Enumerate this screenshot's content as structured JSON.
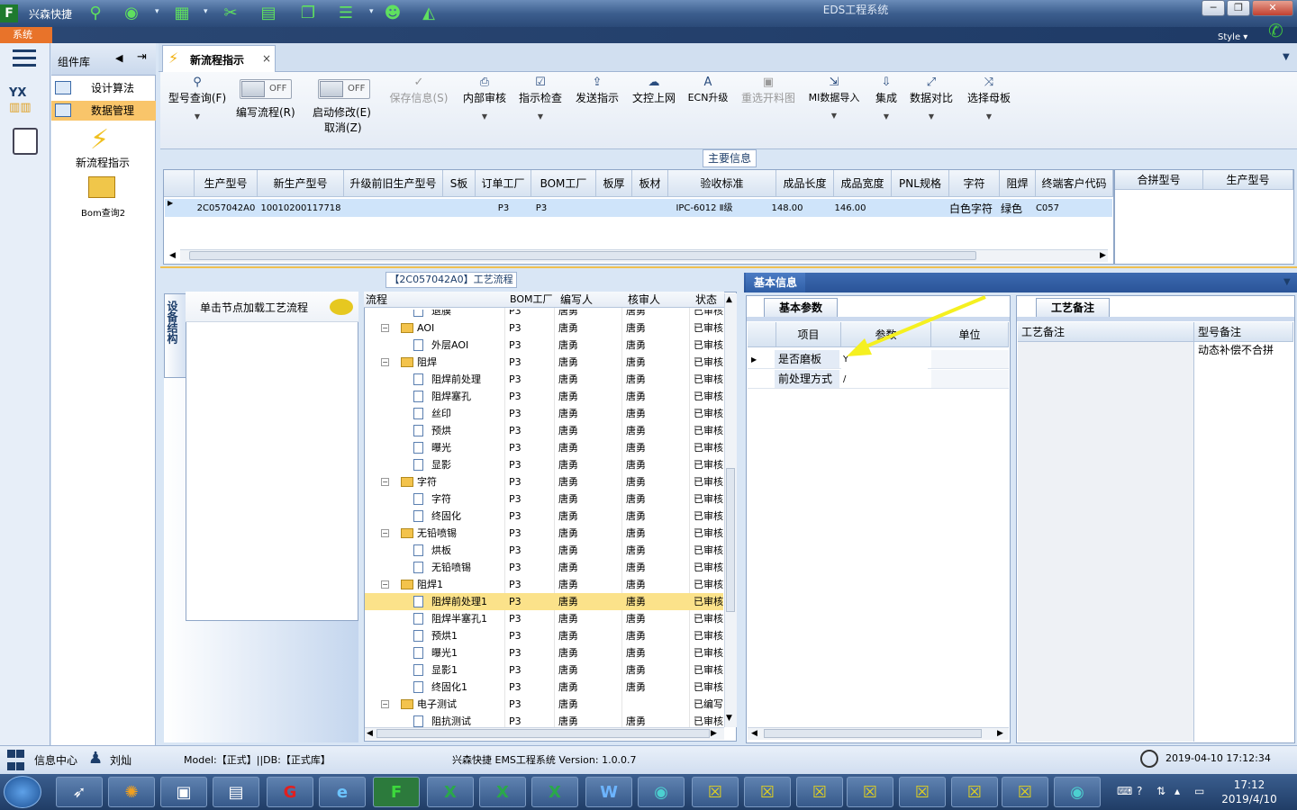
{
  "window": {
    "app_name": "兴森快捷",
    "title": "EDS工程系统",
    "minimize": "─",
    "maximize": "❐",
    "close": "✕"
  },
  "system_tab": "系统",
  "style_label": "Style ▾",
  "sidebar": {
    "title": "组件库",
    "logo_text": "YX",
    "items": [
      {
        "label": "设计算法"
      },
      {
        "label": "数据管理"
      }
    ],
    "shortcuts": [
      {
        "label": "新流程指示",
        "icon": "lightning-icon"
      },
      {
        "label": "Bom查询2",
        "icon": "folder-icon"
      }
    ]
  },
  "doc_tab": {
    "label": "新流程指示",
    "close": "×"
  },
  "toolbar": {
    "items": [
      {
        "label": "型号查询(F)",
        "icon": "search-icon",
        "disabled": false
      },
      {
        "label": "编写流程(R)",
        "toggle": "OFF",
        "disabled": false
      },
      {
        "label": "启动修改(E)",
        "sub": "取消(Z)",
        "toggle": "OFF",
        "disabled": false
      },
      {
        "label": "保存信息(S)",
        "icon": "check-icon",
        "disabled": true
      },
      {
        "label": "内部审核",
        "icon": "printer-icon",
        "disabled": false
      },
      {
        "label": "指示检查",
        "icon": "checkbox-icon",
        "disabled": false
      },
      {
        "label": "发送指示",
        "icon": "upload-icon",
        "disabled": false
      },
      {
        "label": "文控上网",
        "icon": "cloud-upload-icon",
        "disabled": false
      },
      {
        "label": "ECN升级",
        "icon": "font-icon",
        "disabled": false
      },
      {
        "label": "重选开料图",
        "icon": "image-icon",
        "disabled": true
      },
      {
        "label": "MI数据导入",
        "icon": "import-icon",
        "disabled": false
      },
      {
        "label": "集成",
        "icon": "download-icon",
        "disabled": false
      },
      {
        "label": "数据对比",
        "icon": "compare-icon",
        "disabled": false
      },
      {
        "label": "选择母板",
        "icon": "shuffle-icon",
        "disabled": false
      }
    ]
  },
  "main_info": {
    "caption": "主要信息",
    "columns": [
      "生产型号",
      "新生产型号",
      "升级前旧生产型号",
      "S板",
      "订单工厂",
      "BOM工厂",
      "板厚",
      "板材",
      "验收标准",
      "成品长度",
      "成品宽度",
      "PNL规格",
      "字符",
      "阻焊",
      "终端客户代码"
    ],
    "rows": [
      [
        "2C057042A0",
        "10010200117718",
        "",
        "",
        "P3",
        "P3",
        "",
        "",
        "IPC-6012 Ⅱ级",
        "148.00",
        "146.00",
        "",
        "白色字符",
        "绿色",
        "C057"
      ]
    ],
    "side_columns": [
      "合拼型号",
      "生产型号"
    ]
  },
  "side_tab": "设备结构",
  "node_panel": {
    "label": "单击节点加载工艺流程"
  },
  "tree": {
    "caption": "【2C057042A0】工艺流程",
    "columns": [
      "流程",
      "BOM工厂",
      "编写人",
      "核审人",
      "状态"
    ],
    "rows": [
      {
        "level": 1,
        "type": "doc",
        "name": "退膜",
        "bom": "P3",
        "writer": "唐勇",
        "reviewer": "唐勇",
        "status": "已审核"
      },
      {
        "level": 0,
        "type": "folder",
        "name": "AOI",
        "bom": "P3",
        "writer": "唐勇",
        "reviewer": "唐勇",
        "status": "已审核"
      },
      {
        "level": 1,
        "type": "doc",
        "name": "外层AOI",
        "bom": "P3",
        "writer": "唐勇",
        "reviewer": "唐勇",
        "status": "已审核"
      },
      {
        "level": 0,
        "type": "folder",
        "name": "阻焊",
        "bom": "P3",
        "writer": "唐勇",
        "reviewer": "唐勇",
        "status": "已审核"
      },
      {
        "level": 1,
        "type": "doc",
        "name": "阻焊前处理",
        "bom": "P3",
        "writer": "唐勇",
        "reviewer": "唐勇",
        "status": "已审核"
      },
      {
        "level": 1,
        "type": "doc",
        "name": "阻焊塞孔",
        "bom": "P3",
        "writer": "唐勇",
        "reviewer": "唐勇",
        "status": "已审核"
      },
      {
        "level": 1,
        "type": "doc",
        "name": "丝印",
        "bom": "P3",
        "writer": "唐勇",
        "reviewer": "唐勇",
        "status": "已审核"
      },
      {
        "level": 1,
        "type": "doc",
        "name": "预烘",
        "bom": "P3",
        "writer": "唐勇",
        "reviewer": "唐勇",
        "status": "已审核"
      },
      {
        "level": 1,
        "type": "doc",
        "name": "曝光",
        "bom": "P3",
        "writer": "唐勇",
        "reviewer": "唐勇",
        "status": "已审核"
      },
      {
        "level": 1,
        "type": "doc",
        "name": "显影",
        "bom": "P3",
        "writer": "唐勇",
        "reviewer": "唐勇",
        "status": "已审核"
      },
      {
        "level": 0,
        "type": "folder",
        "name": "字符",
        "bom": "P3",
        "writer": "唐勇",
        "reviewer": "唐勇",
        "status": "已审核"
      },
      {
        "level": 1,
        "type": "doc",
        "name": "字符",
        "bom": "P3",
        "writer": "唐勇",
        "reviewer": "唐勇",
        "status": "已审核"
      },
      {
        "level": 1,
        "type": "doc",
        "name": "终固化",
        "bom": "P3",
        "writer": "唐勇",
        "reviewer": "唐勇",
        "status": "已审核"
      },
      {
        "level": 0,
        "type": "folder",
        "name": "无铅喷锡",
        "bom": "P3",
        "writer": "唐勇",
        "reviewer": "唐勇",
        "status": "已审核"
      },
      {
        "level": 1,
        "type": "doc",
        "name": "烘板",
        "bom": "P3",
        "writer": "唐勇",
        "reviewer": "唐勇",
        "status": "已审核"
      },
      {
        "level": 1,
        "type": "doc",
        "name": "无铅喷锡",
        "bom": "P3",
        "writer": "唐勇",
        "reviewer": "唐勇",
        "status": "已审核"
      },
      {
        "level": 0,
        "type": "folder",
        "name": "阻焊1",
        "bom": "P3",
        "writer": "唐勇",
        "reviewer": "唐勇",
        "status": "已审核"
      },
      {
        "level": 1,
        "type": "doc",
        "name": "阻焊前处理1",
        "bom": "P3",
        "writer": "唐勇",
        "reviewer": "唐勇",
        "status": "已审核",
        "selected": true
      },
      {
        "level": 1,
        "type": "doc",
        "name": "阻焊半塞孔1",
        "bom": "P3",
        "writer": "唐勇",
        "reviewer": "唐勇",
        "status": "已审核"
      },
      {
        "level": 1,
        "type": "doc",
        "name": "预烘1",
        "bom": "P3",
        "writer": "唐勇",
        "reviewer": "唐勇",
        "status": "已审核"
      },
      {
        "level": 1,
        "type": "doc",
        "name": "曝光1",
        "bom": "P3",
        "writer": "唐勇",
        "reviewer": "唐勇",
        "status": "已审核"
      },
      {
        "level": 1,
        "type": "doc",
        "name": "显影1",
        "bom": "P3",
        "writer": "唐勇",
        "reviewer": "唐勇",
        "status": "已审核"
      },
      {
        "level": 1,
        "type": "doc",
        "name": "终固化1",
        "bom": "P3",
        "writer": "唐勇",
        "reviewer": "唐勇",
        "status": "已审核"
      },
      {
        "level": 0,
        "type": "folder",
        "name": "电子测试",
        "bom": "P3",
        "writer": "唐勇",
        "reviewer": "",
        "status": "已编写"
      },
      {
        "level": 1,
        "type": "doc",
        "name": "阻抗测试",
        "bom": "P3",
        "writer": "唐勇",
        "reviewer": "唐勇",
        "status": "已审核"
      }
    ]
  },
  "basic_info": {
    "tab": "基本信息",
    "params_tab": "基本参数",
    "columns": [
      "项目",
      "参数",
      "单位"
    ],
    "rows": [
      {
        "item": "是否磨板",
        "value": "Y",
        "unit": ""
      },
      {
        "item": "前处理方式",
        "value": "/",
        "unit": ""
      }
    ]
  },
  "remarks": {
    "tab": "工艺备注",
    "columns": [
      "工艺备注",
      "型号备注"
    ],
    "model_remark": "动态补偿不合拼"
  },
  "statusbar": {
    "info_center": "信息中心",
    "user": "刘灿",
    "db": "Model:【正式】||DB:【正式库】",
    "version": "兴森快捷 EMS工程系统 Version: 1.0.0.7",
    "datetime": "2019-04-10 17:12:34"
  },
  "taskbar": {
    "time": "17:12",
    "date": "2019/4/10"
  },
  "colors": {
    "accent": "#2f5ea6",
    "selection": "#fbe28a",
    "row_select": "#cfe4fa",
    "arrow": "#f5f020"
  }
}
